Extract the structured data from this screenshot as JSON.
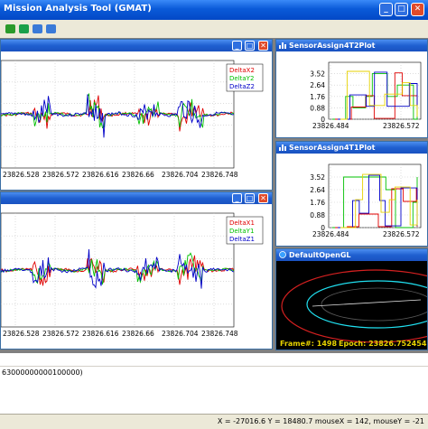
{
  "app": {
    "title": "Mission Analysis Tool (GMAT)"
  },
  "colors": {
    "red": "#e00000",
    "green": "#00c000",
    "blue": "#0000c8",
    "yellow": "#e6d200",
    "cyan": "#20e0f0",
    "orbit_red": "#d42020"
  },
  "window_buttons": {
    "minimize": "_",
    "maximize": "□",
    "close": "✕"
  },
  "toolbar": {
    "icons": [
      "run-icon",
      "stop-icon",
      "zoom-in-icon",
      "zoom-out-icon"
    ]
  },
  "plots": {
    "delta2": {
      "legend": [
        "DeltaX2",
        "DeltaY2",
        "DeltaZ2"
      ],
      "x_ticks": [
        "23826.528",
        "23826.572",
        "23826.616",
        "23826.66",
        "23826.704",
        "23826.748"
      ]
    },
    "delta1": {
      "legend": [
        "DeltaX1",
        "DeltaY1",
        "DeltaZ1"
      ],
      "x_ticks": [
        "23826.528",
        "23826.572",
        "23826.616",
        "23826.66",
        "23826.704",
        "23826.748"
      ]
    }
  },
  "sensor_plots": {
    "sensor4t2": {
      "title": "SensorAssign4T2Plot",
      "y_ticks": [
        "3.52",
        "2.64",
        "1.76",
        "0.88",
        "0"
      ],
      "x_ticks": [
        "23826.484",
        "23826.572"
      ]
    },
    "sensor4t1": {
      "title": "SensorAssign4T1Plot",
      "y_ticks": [
        "3.52",
        "2.64",
        "1.76",
        "0.88",
        "0"
      ],
      "x_ticks": [
        "23826.484",
        "23826.572"
      ]
    }
  },
  "opengl": {
    "title": "DefaultOpenGL",
    "frame_label": "Frame#: 1498",
    "epoch_label": "Epoch: 23826.752454"
  },
  "messages": {
    "line": "63000000000100000)"
  },
  "status": {
    "coords": "X = -27016.6  Y = 18480.7  mouseX = 142, mouseY = -21"
  },
  "chart_data": [
    {
      "type": "line",
      "title": "",
      "xlabel": "",
      "ylabel": "",
      "x_ticks": [
        "23826.528",
        "23826.572",
        "23826.616",
        "23826.66",
        "23826.704",
        "23826.748"
      ],
      "series": [
        {
          "name": "DeltaX2",
          "color": "#e00000"
        },
        {
          "name": "DeltaY2",
          "color": "#00c000"
        },
        {
          "name": "DeltaZ2",
          "color": "#0000c8"
        }
      ],
      "grid": true,
      "legend": "top-right"
    },
    {
      "type": "line",
      "title": "",
      "xlabel": "",
      "ylabel": "",
      "x_ticks": [
        "23826.528",
        "23826.572",
        "23826.616",
        "23826.66",
        "23826.704",
        "23826.748"
      ],
      "series": [
        {
          "name": "DeltaX1",
          "color": "#e00000"
        },
        {
          "name": "DeltaY1",
          "color": "#00c000"
        },
        {
          "name": "DeltaZ1",
          "color": "#0000c8"
        }
      ],
      "grid": true,
      "legend": "top-right"
    },
    {
      "type": "line",
      "title": "SensorAssign4T2Plot",
      "y_ticks": [
        "3.52",
        "2.64",
        "1.76",
        "0.88",
        "0"
      ],
      "x_ticks": [
        "23826.484",
        "23826.572"
      ],
      "ylim": [
        0,
        4.4
      ],
      "grid": true
    },
    {
      "type": "line",
      "title": "SensorAssign4T1Plot",
      "y_ticks": [
        "3.52",
        "2.64",
        "1.76",
        "0.88",
        "0"
      ],
      "x_ticks": [
        "23826.484",
        "23826.572"
      ],
      "ylim": [
        0,
        4.4
      ],
      "grid": true
    }
  ]
}
